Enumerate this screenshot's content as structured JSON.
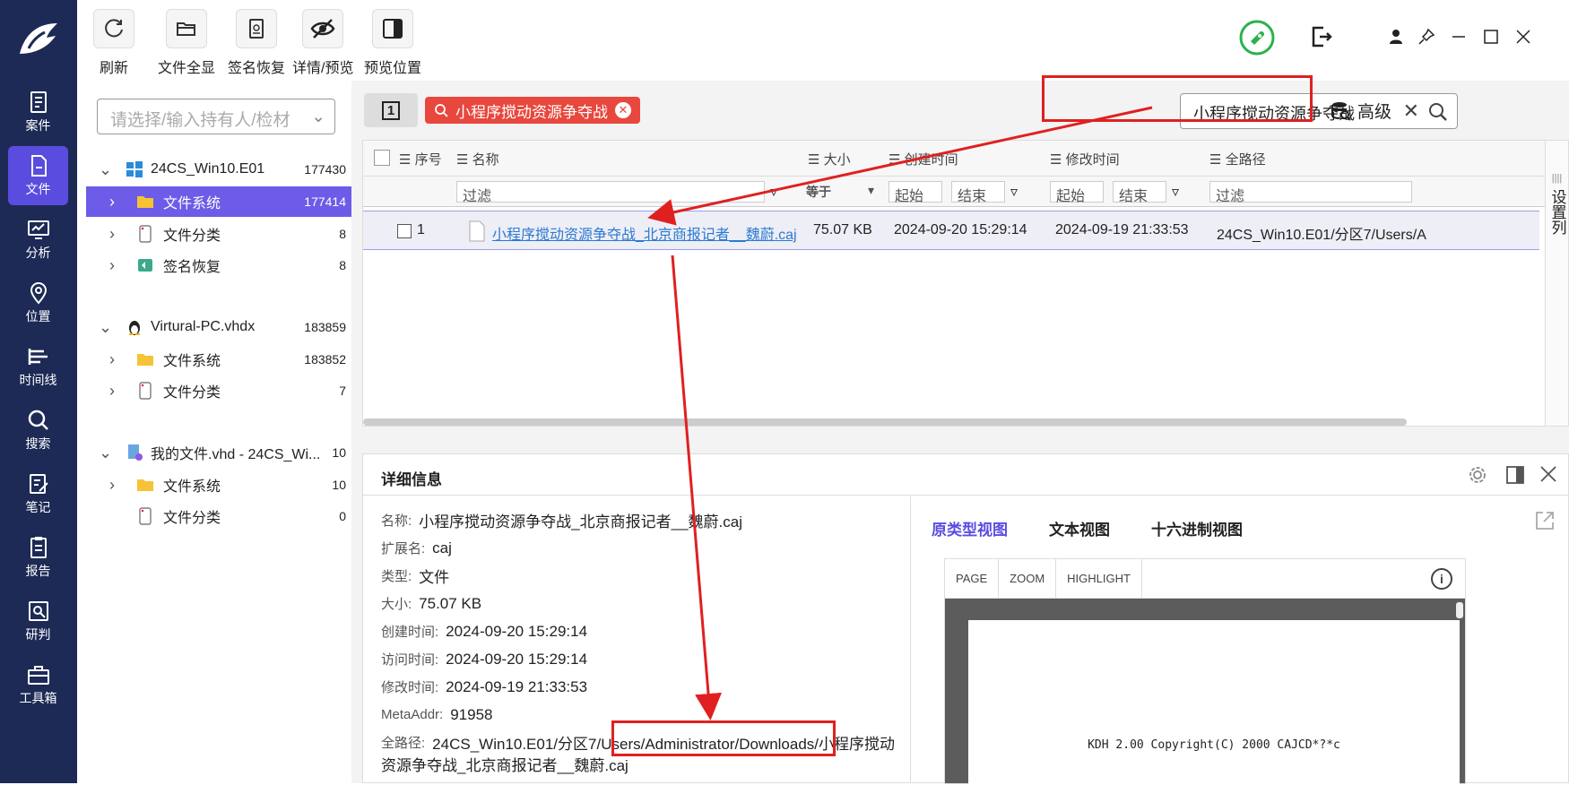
{
  "nav": {
    "items": [
      {
        "label": "案件",
        "icon": "case-icon"
      },
      {
        "label": "文件",
        "icon": "file-icon"
      },
      {
        "label": "分析",
        "icon": "analysis-icon"
      },
      {
        "label": "位置",
        "icon": "location-icon"
      },
      {
        "label": "时间线",
        "icon": "timeline-icon"
      },
      {
        "label": "搜索",
        "icon": "search-icon"
      },
      {
        "label": "笔记",
        "icon": "note-icon"
      },
      {
        "label": "报告",
        "icon": "report-icon"
      },
      {
        "label": "研判",
        "icon": "judge-icon"
      },
      {
        "label": "工具箱",
        "icon": "toolbox-icon"
      }
    ],
    "active": "文件"
  },
  "toolbar": {
    "refresh": "刷新",
    "show_all": "文件全显",
    "sig_recover": "签名恢复",
    "details_preview": "详情/预览",
    "preview_pos": "预览位置"
  },
  "left": {
    "combo_placeholder": "请选择/输入持有人/检材",
    "tree": [
      {
        "label": "24CS_Win10.E01",
        "count": "177430"
      },
      {
        "label": "文件系统",
        "count": "177414"
      },
      {
        "label": "文件分类",
        "count": "8"
      },
      {
        "label": "签名恢复",
        "count": "8"
      },
      {
        "label": "Virtural-PC.vhdx",
        "count": "183859"
      },
      {
        "label": "文件系统",
        "count": "183852"
      },
      {
        "label": "文件分类",
        "count": "7"
      },
      {
        "label": "我的文件.vhd - 24CS_Wi...",
        "count": "10"
      },
      {
        "label": "文件系统",
        "count": "10"
      },
      {
        "label": "文件分类",
        "count": "0"
      }
    ]
  },
  "search": {
    "page_btn": "1",
    "tag": "小程序搅动资源争夺战",
    "value": "小程序搅动资源争夺战",
    "advanced": "高级"
  },
  "grid": {
    "headers": {
      "seq": "序号",
      "name": "名称",
      "size": "大小",
      "created": "创建时间",
      "modified": "修改时间",
      "path": "全路径"
    },
    "filters": {
      "name": "过滤",
      "size_op": "等于",
      "start1": "起始",
      "end1": "结束",
      "start2": "起始",
      "end2": "结束",
      "path": "过滤"
    },
    "row": {
      "seq": "1",
      "name": "小程序搅动资源争夺战_北京商报记者__魏蔚.caj",
      "size": "75.07 KB",
      "created": "2024-09-20 15:29:14",
      "modified": "2024-09-19 21:33:53",
      "path": "24CS_Win10.E01/分区7/Users/A"
    },
    "set_col": "设置列"
  },
  "details": {
    "title": "详细信息",
    "props": [
      {
        "k": "名称:",
        "v": "小程序搅动资源争夺战_北京商报记者__魏蔚.caj"
      },
      {
        "k": "扩展名:",
        "v": "caj"
      },
      {
        "k": "类型:",
        "v": "文件"
      },
      {
        "k": "大小:",
        "v": "75.07 KB"
      },
      {
        "k": "创建时间:",
        "v": "2024-09-20 15:29:14"
      },
      {
        "k": "访问时间:",
        "v": "2024-09-20 15:29:14"
      },
      {
        "k": "修改时间:",
        "v": "2024-09-19 21:33:53"
      },
      {
        "k": "MetaAddr:",
        "v": "91958"
      },
      {
        "k": "全路径:",
        "v": "24CS_Win10.E01/分区7/Users/Administrator/Downloads/小程序搅动"
      }
    ],
    "path_cont": "资源争夺战_北京商报记者__魏蔚.caj",
    "tabs": [
      "原类型视图",
      "文本视图",
      "十六进制视图"
    ],
    "viewer_tools": [
      "PAGE",
      "ZOOM",
      "HIGHLIGHT"
    ],
    "viewer_text": "KDH 2.00 Copyright(C) 2000 CAJCD*?*c"
  },
  "colors": {
    "nav_bg": "#1d2a55",
    "accent": "#5b4ce0",
    "tag_red": "#e8473d",
    "annotation_red": "#e02020"
  }
}
